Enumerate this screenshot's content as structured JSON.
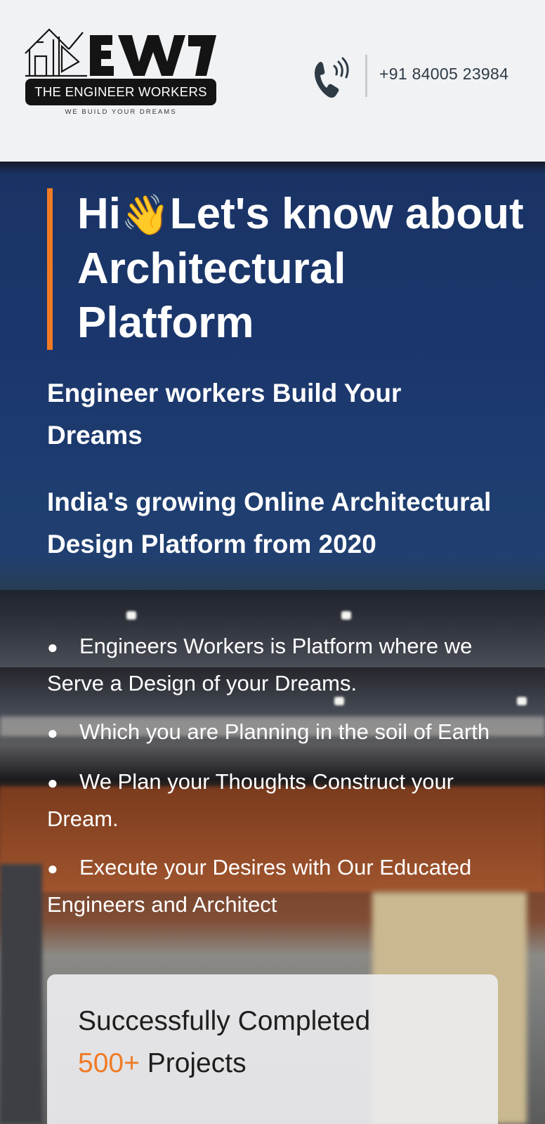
{
  "header": {
    "logo": {
      "mark_text": "TEW",
      "brand_name": "THE ENGINEER WORKERS",
      "tagline": "WE BUILD YOUR DREAMS"
    },
    "phone": {
      "icon": "phone-icon",
      "number": "+91 84005 23984"
    }
  },
  "hero": {
    "title_greeting": "Hi",
    "title_emoji": "👋",
    "title_rest": "Let's know about Architectural Platform",
    "subtitle": "Engineer workers Build Your Dreams",
    "subtitle2": "India's growing Online Architectural Design Platform from 2020",
    "bullets": [
      "Engineers Workers is Platform where we Serve a Design of your Dreams.",
      "Which you are Planning in the soil of Earth",
      "We Plan your Thoughts Construct your Dream.",
      "Execute your Desires with Our Educated Engineers and Architect"
    ],
    "stats": {
      "line1": "Successfully Completed",
      "count": "500+",
      "label": "Projects"
    }
  },
  "colors": {
    "accent": "#f07a24",
    "hero_blue": "#1f3f7c",
    "header_bg": "#f1f2f4",
    "phone_icon": "#2e3b45"
  }
}
